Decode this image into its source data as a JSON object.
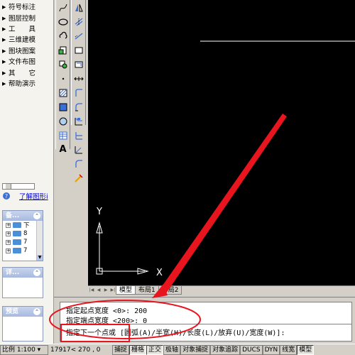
{
  "menu": {
    "items": [
      "符号标注",
      "图层控制",
      "工　　具",
      "三维建模",
      "图块图案",
      "文件布图",
      "其　　它",
      "帮助演示"
    ]
  },
  "left_panel": {
    "link_text": "了解图形i",
    "panel1_title": "备...",
    "tree_items": [
      "下",
      "8",
      "7",
      "7"
    ],
    "panel2_title": "详...",
    "panel3_title": "预览"
  },
  "toolbar_icons": {
    "left": [
      "spline-icon",
      "ellipse-icon",
      "revcloud-icon",
      "insert-block-icon",
      "make-block-icon",
      "point-icon",
      "hatch-icon",
      "gradient-icon",
      "region-icon",
      "table-icon",
      "multiline-text-icon"
    ],
    "right": [
      "mirror-icon",
      "offset-icon",
      "array-icon",
      "move-icon",
      "rotate-icon",
      "scale-icon",
      "stretch-icon",
      "trim-icon",
      "extend-icon",
      "break-icon",
      "chamfer-icon",
      "fillet-icon",
      "explode-icon"
    ]
  },
  "text_tool_label": "A",
  "canvas": {
    "background": "#000000",
    "ucs_x_label": "X",
    "ucs_y_label": "Y"
  },
  "tabs": [
    "模型",
    "布局1",
    "布局2"
  ],
  "command": {
    "line1": "指定起点宽度 <0>: 200",
    "line2": "指定端点宽度 <200>: 0",
    "line3": "指定下一个点或 [圆弧(A)/半宽(H)/长度(L)/放弃(U)/宽度(W)]:"
  },
  "status": {
    "scale": "比例 1:100 ▾",
    "coords": "17917< 270  , 0",
    "buttons": [
      "捕捉",
      "栅格",
      "正交",
      "极轴",
      "对象捕捉",
      "对象追踪",
      "DUCS",
      "DYN",
      "线宽",
      "模型"
    ],
    "pressed": [
      "栅格",
      "正交",
      "模型"
    ]
  },
  "colors": {
    "annotation_red": "#e8141e",
    "link_blue": "#0000cc"
  }
}
